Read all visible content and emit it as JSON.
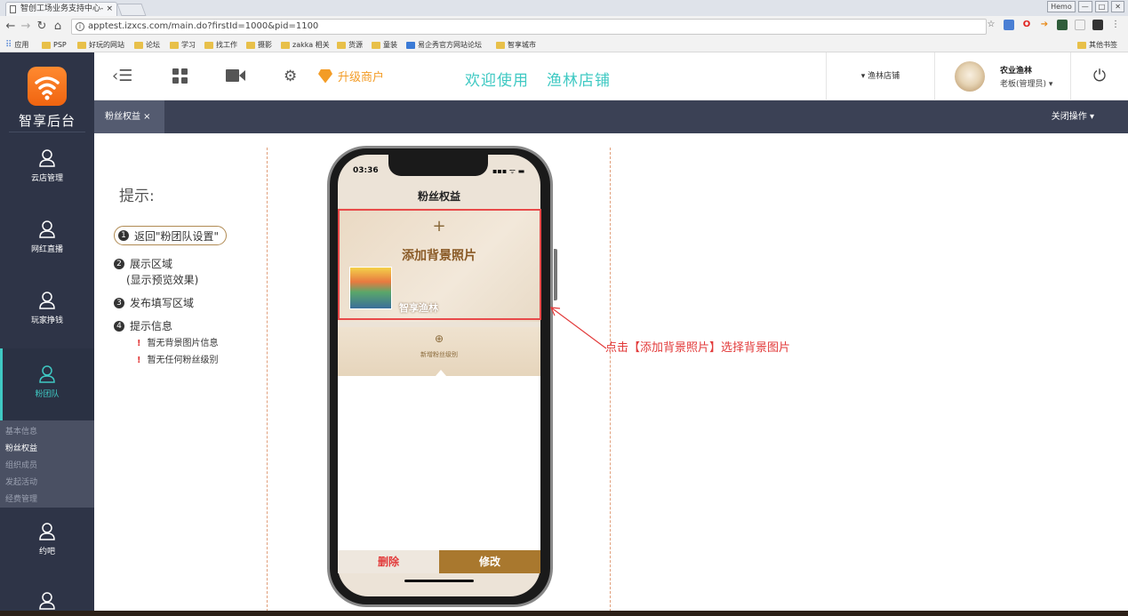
{
  "browser": {
    "tab_title": "智创工场业务支持中心-",
    "tab_close": "×",
    "window_buttons": [
      "Hemo",
      "—",
      "□",
      "✕"
    ],
    "url": "apptest.izxcs.com/main.do?firstId=1000&pid=1100",
    "bookmarks": [
      "应用",
      "PSP",
      "好玩的网站",
      "论坛",
      "学习",
      "找工作",
      "摄影",
      "zakka 相关",
      "货源",
      "童装",
      "易企秀官方网站论坛",
      "智享城市"
    ],
    "other_bookmarks": "其他书签"
  },
  "sidebar": {
    "logo_text": "智享后台",
    "items": [
      {
        "label": "云店管理"
      },
      {
        "label": "网红直播"
      },
      {
        "label": "玩家挣钱"
      },
      {
        "label": "粉团队"
      },
      {
        "label": "约吧"
      }
    ],
    "submenu": [
      "基本信息",
      "粉丝权益",
      "组织成员",
      "发起活动",
      "经费管理"
    ]
  },
  "topbar": {
    "upgrade_label": "升级商户",
    "welcome": "欢迎使用",
    "store_name": "渔林店铺",
    "store_select": "▾ 渔林店铺",
    "user_name": "农业渔林",
    "user_role": "老板(管理员) ▾"
  },
  "tabs": {
    "current_tab": "粉丝权益 ×",
    "close_ops": "关闭操作 ▾"
  },
  "hints": {
    "title": "提示:",
    "step1": "返回\"粉团队设置\"",
    "step2": "展示区域",
    "step2_sub": "(显示预览效果)",
    "step3": "发布填写区域",
    "step4": "提示信息",
    "warn1": "暂无背景图片信息",
    "warn2": "暂无任何粉丝级别",
    "numbers": [
      "1",
      "2",
      "3",
      "4"
    ]
  },
  "phone": {
    "time": "03:36",
    "status": "▪▪▪ ᯤ ▬",
    "title": "粉丝权益",
    "add_bg_plus": "+",
    "add_bg": "添加背景照片",
    "shop_name": "智享渔林",
    "new_level_plus": "⊕",
    "new_level": "新增粉丝级别",
    "delete_label": "删除",
    "edit_label": "修改"
  },
  "annotation": "点击【添加背景照片】选择背景图片",
  "colors": {
    "sidebar": "#2e3447",
    "accent": "#3fc9c3",
    "upgrade": "#f39c26",
    "edit_button": "#a9782e",
    "delete_text": "#e23a3a"
  }
}
